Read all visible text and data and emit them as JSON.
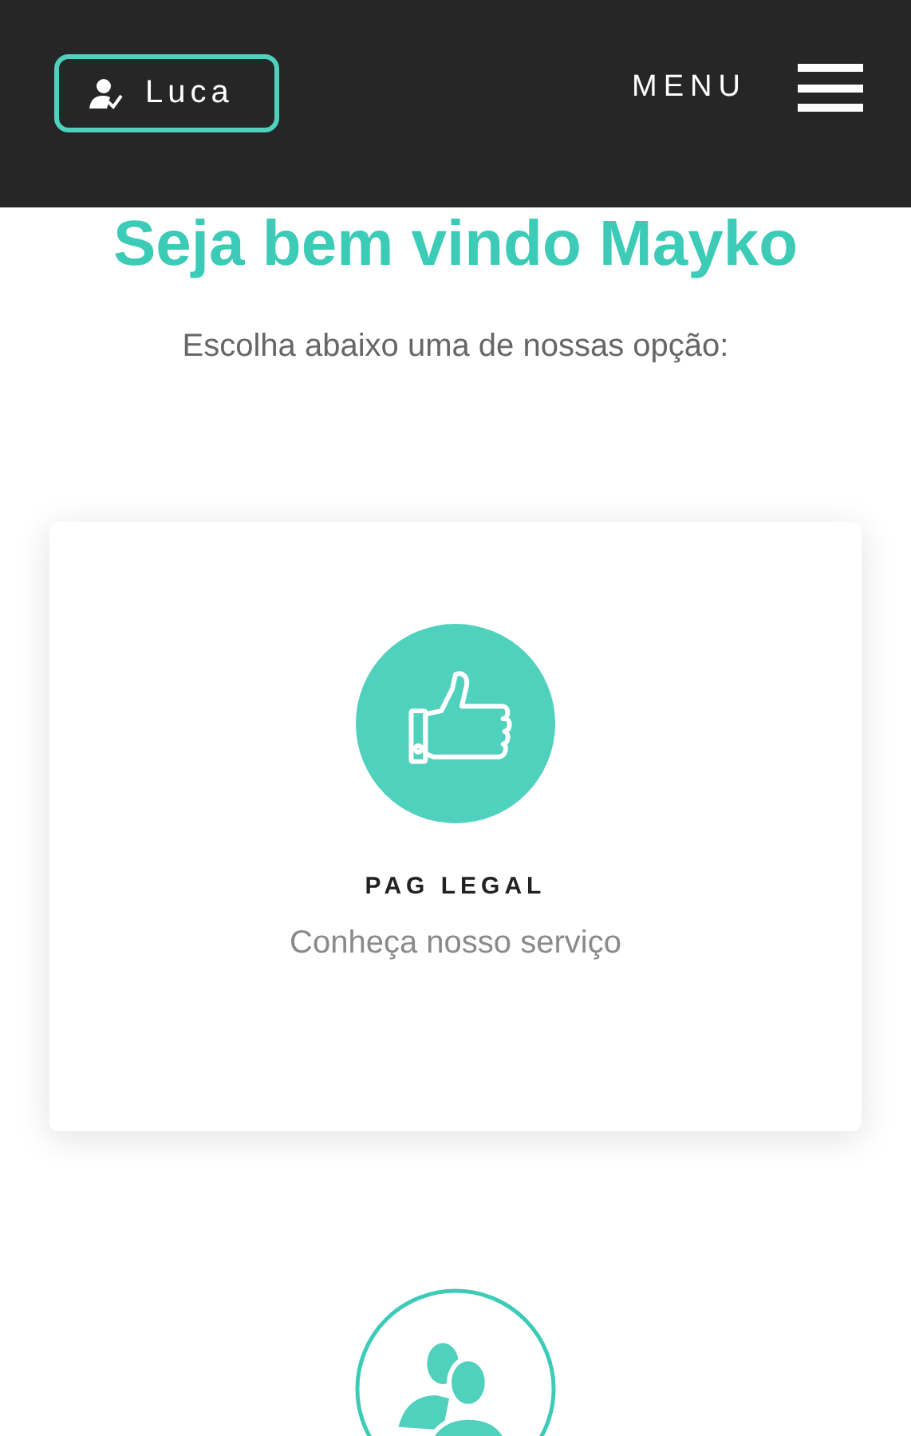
{
  "header": {
    "user_button": {
      "label": "Luca"
    },
    "menu": {
      "label": "MENU"
    }
  },
  "welcome": {
    "title": "Seja bem vindo Mayko",
    "subtitle": "Escolha abaixo uma de nossas opção:"
  },
  "cards": [
    {
      "kind": "like",
      "title": "PAG LEGAL",
      "subtitle": "Conheça nosso serviço"
    },
    {
      "kind": "people"
    }
  ]
}
